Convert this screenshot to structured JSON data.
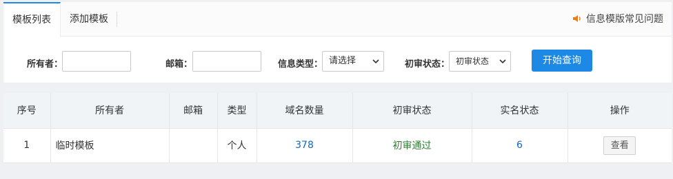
{
  "tabs": [
    {
      "label": "模板列表",
      "active": true
    },
    {
      "label": "添加模板",
      "active": false
    }
  ],
  "help": {
    "label": "信息模版常见问题",
    "icon": "speaker-icon",
    "icon_color": "#f57c00"
  },
  "filters": {
    "owner_label": "所有者：",
    "owner_value": "",
    "email_label": "邮箱：",
    "email_value": "",
    "type_label": "信息类型：",
    "type_selected": "请选择",
    "review_label": "初审状态：",
    "review_selected": "初审状态",
    "query_button": "开始查询"
  },
  "table": {
    "headers": [
      "序号",
      "所有者",
      "邮箱",
      "类型",
      "域名数量",
      "初审状态",
      "实名状态",
      "操作"
    ],
    "rows": [
      {
        "index": "1",
        "owner": "临时模板",
        "email": "",
        "type": "个人",
        "domain_count": "378",
        "review_status": "初审通过",
        "realname_status": "6",
        "action": "查看"
      }
    ]
  },
  "colors": {
    "accent": "#1e88e5",
    "link": "#1565c0",
    "success": "#2e7d32"
  }
}
